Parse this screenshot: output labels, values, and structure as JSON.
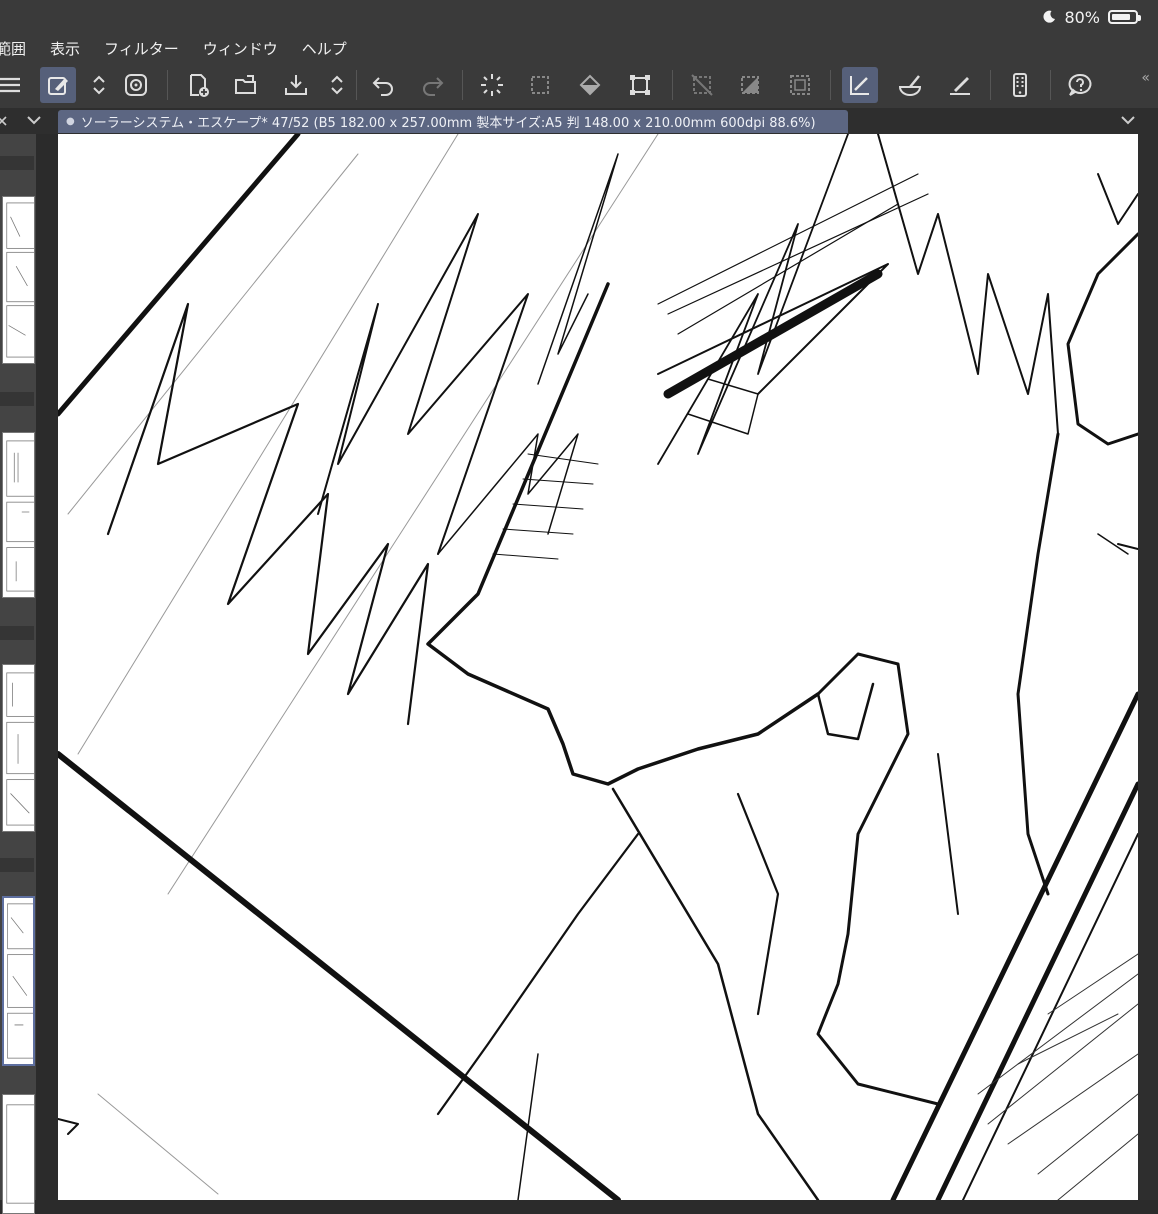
{
  "status": {
    "battery": "80%",
    "battery_level": 0.8
  },
  "menu": [
    "範囲",
    "表示",
    "フィルター",
    "ウィンドウ",
    "ヘルプ"
  ],
  "document": {
    "tab_title": "ソーラーシステム・エスケープ* 47/52 (B5 182.00 x 257.00mm 製本サイズ:A5 判 148.00 x 210.00mm 600dpi 88.6%)"
  },
  "toolbar_icons": [
    "menu-icon",
    "sub-tool-icon",
    "chevron-updown-icon",
    "swirl-icon",
    "new-page-icon",
    "open-folder-icon",
    "save-icon",
    "chevron-updown-icon",
    "undo-icon",
    "redo-icon",
    "selection-spinner-icon",
    "selection-dashed-icon",
    "fill-icon",
    "transform-icon",
    "deselect-icon",
    "invert-selection-icon",
    "selection-border-icon",
    "ruler-pen-icon",
    "brush-icon",
    "pen-icon",
    "smartphone-icon",
    "help-icon"
  ],
  "colors": {
    "accent": "#56607a",
    "tab": "#5c6682",
    "chrome": "#3a3a3a"
  }
}
